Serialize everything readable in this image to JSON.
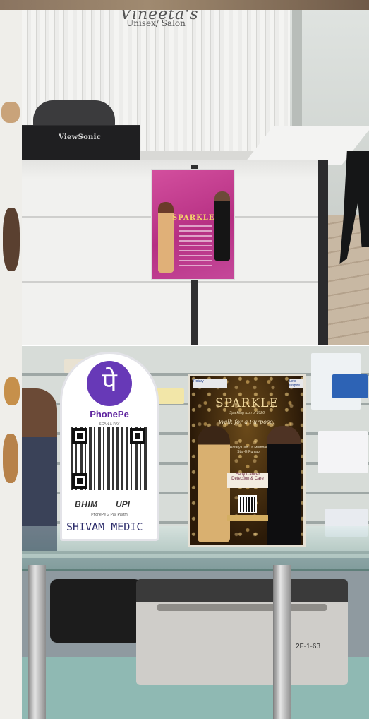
{
  "top_photo": {
    "salon_sign": {
      "name": "Vineeta's",
      "subtitle": "Unisex/ Salon"
    },
    "monitor_brand": "ViewSonic",
    "poster": {
      "title": "SPARKLE"
    }
  },
  "bottom_photo": {
    "phonepe": {
      "brand": "PhonePe",
      "scan_text": "SCAN & PAY",
      "sub_text": "",
      "bhim": "BHIM",
      "upi": "UPI",
      "pay_row": "PhonePe  G Pay  Paytm",
      "handwritten": "SHIVAM MEDIC"
    },
    "sparkle": {
      "badge_left": "Rotary",
      "badge_right": "Lets Inspire",
      "title": "SPARKLE",
      "subtitle": "Sparkling Icon of 2026",
      "tagline": "Walk for a Purpose!",
      "rotary": "Rotary Club Of Mumbai Star-E-Punjab",
      "cancer": "Early Cancer Detection & Care",
      "date": ""
    },
    "machine_tag": "2F-1-63"
  },
  "colors": {
    "phonepe_purple": "#6739b7",
    "poster_pink": "#c5489a",
    "sparkle_gold": "#d4ae62"
  }
}
